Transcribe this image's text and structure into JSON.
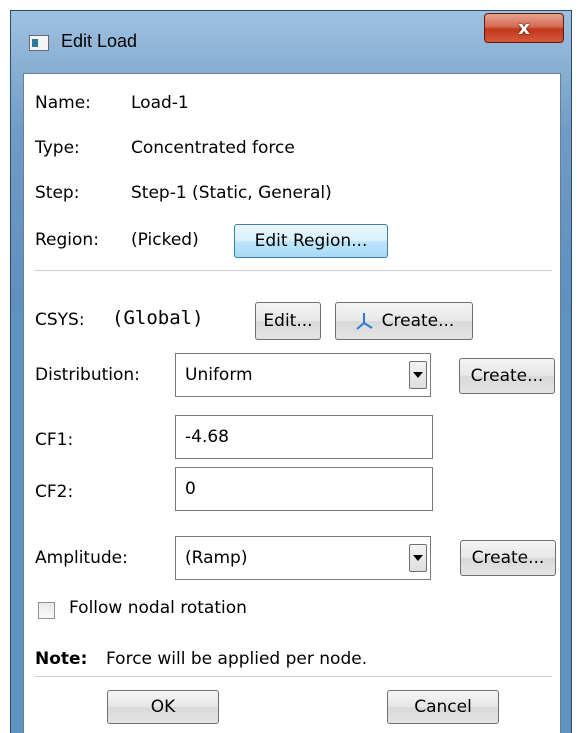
{
  "window": {
    "title": "Edit Load",
    "close_glyph": "x",
    "colors": {
      "frame": "#5e93c4",
      "close": "#c2361c"
    }
  },
  "info": {
    "name_label": "Name:",
    "name_value": "Load-1",
    "type_label": "Type:",
    "type_value": "Concentrated force",
    "step_label": "Step:",
    "step_value": "Step-1 (Static, General)",
    "region_label": "Region:",
    "region_value": "(Picked)",
    "edit_region_button": "Edit Region..."
  },
  "csys": {
    "label": "CSYS:",
    "value": "(Global)",
    "edit_button": "Edit...",
    "create_button": "Create...",
    "create_icon": "axes-icon"
  },
  "form": {
    "distribution_label": "Distribution:",
    "distribution_value": "Uniform",
    "distribution_create_button": "Create...",
    "cf1_label": "CF1:",
    "cf1_value": "-4.68",
    "cf2_label": "CF2:",
    "cf2_value": "0",
    "amplitude_label": "Amplitude:",
    "amplitude_value": "(Ramp)",
    "amplitude_create_button": "Create...",
    "follow_rotation_label": "Follow nodal rotation",
    "follow_rotation_checked": false
  },
  "note": {
    "prefix": "Note:",
    "text": "Force will be applied per node."
  },
  "footer": {
    "ok_button": "OK",
    "cancel_button": "Cancel"
  }
}
